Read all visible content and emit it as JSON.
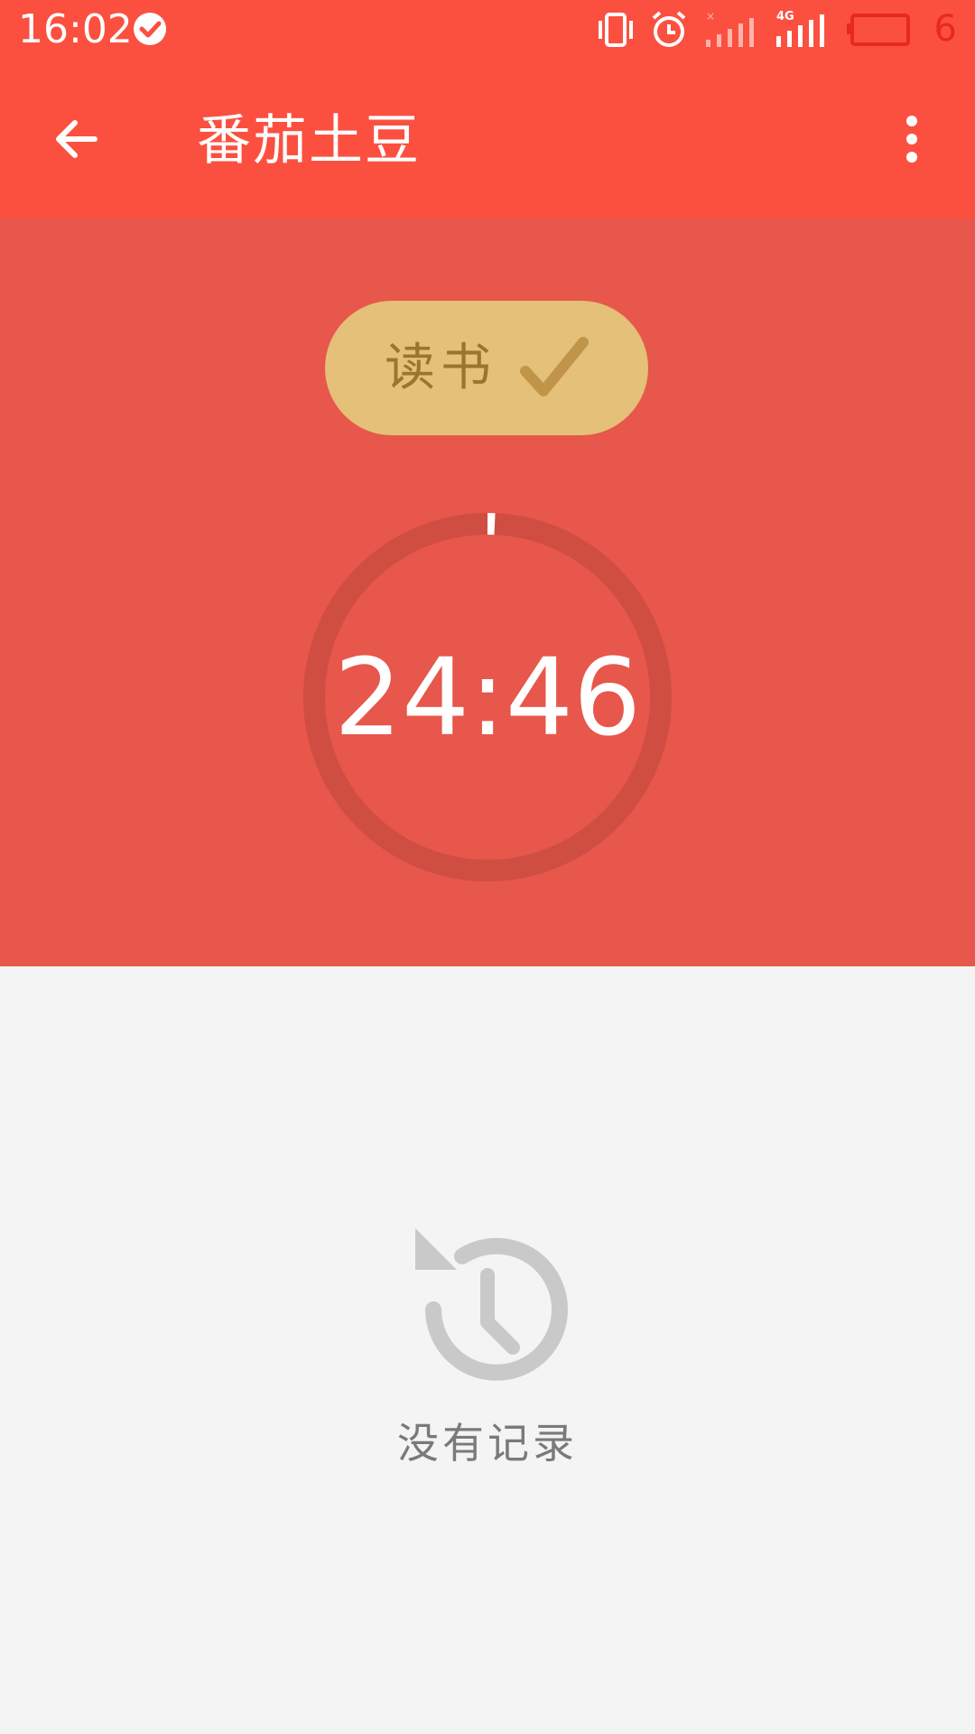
{
  "status_bar": {
    "time": "16:02",
    "battery_level": "6",
    "network_label": "4G"
  },
  "app_bar": {
    "title": "番茄土豆",
    "back_icon": "arrow-back-icon",
    "more_icon": "more-vert-icon"
  },
  "timer": {
    "task_label": "读书",
    "time_remaining": "24:46"
  },
  "history": {
    "empty_text": "没有记录",
    "icon": "history-icon"
  },
  "colors": {
    "app_bar": "#fb5040",
    "timer_panel": "#e7574b",
    "task_chip": "#e4c078",
    "task_text": "#9b7430",
    "background": "#f4f4f4"
  }
}
